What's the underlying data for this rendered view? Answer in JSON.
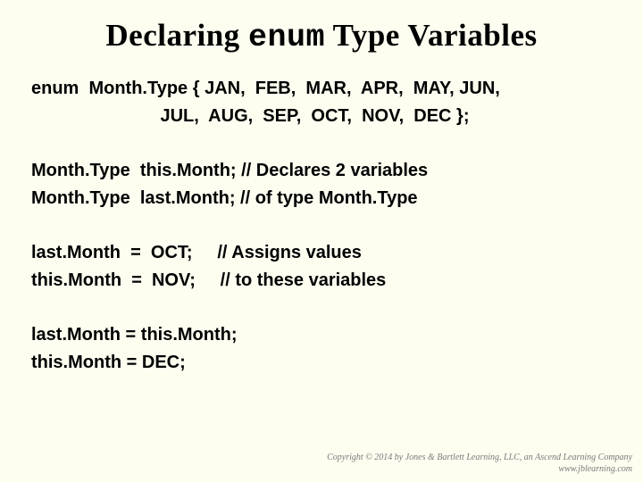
{
  "title": {
    "part1": "Declaring ",
    "enum": "enum",
    "part2": " Type Variables"
  },
  "code": {
    "g1l1": "enum  Month.Type { JAN,  FEB,  MAR,  APR,  MAY, JUN,",
    "g1l2": "                          JUL,  AUG,  SEP,  OCT,  NOV,  DEC };",
    "g2l1": "Month.Type  this.Month; // Declares 2 variables",
    "g2l2": "Month.Type  last.Month; // of type Month.Type",
    "g3l1": "last.Month  =  OCT;     // Assigns values",
    "g3l2": "this.Month  =  NOV;     // to these variables",
    "g4l1": "last.Month = this.Month;",
    "g4l2": "this.Month = DEC;"
  },
  "copyright": {
    "line1": "Copyright © 2014 by Jones & Bartlett Learning, LLC, an Ascend Learning Company",
    "line2": "www.jblearning.com"
  }
}
